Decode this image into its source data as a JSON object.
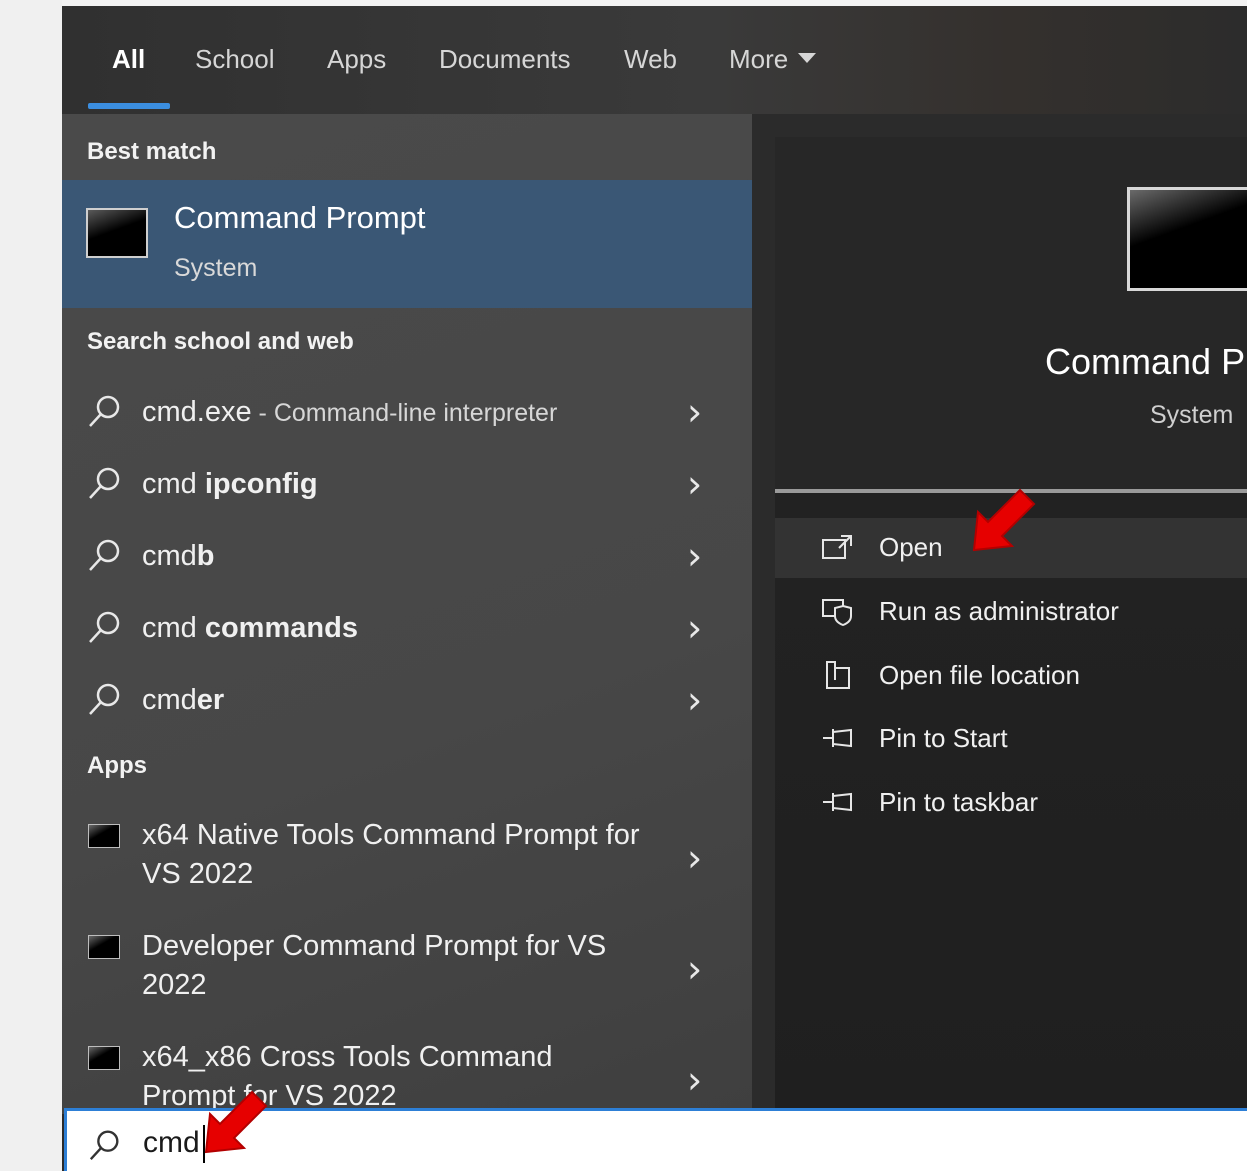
{
  "tabs": [
    {
      "label": "All",
      "active": true
    },
    {
      "label": "School"
    },
    {
      "label": "Apps"
    },
    {
      "label": "Documents"
    },
    {
      "label": "Web"
    },
    {
      "label": "More"
    }
  ],
  "best_match": {
    "heading": "Best match",
    "title": "Command Prompt",
    "subtitle": "System"
  },
  "web_section": {
    "heading": "Search school and web",
    "items": [
      {
        "prefix": "cmd.exe",
        "bold": "",
        "desc": " - Command-line interpreter"
      },
      {
        "prefix": "cmd ",
        "bold": "ipconfig",
        "desc": ""
      },
      {
        "prefix": "cmd",
        "bold": "b",
        "desc": ""
      },
      {
        "prefix": "cmd ",
        "bold": "commands",
        "desc": ""
      },
      {
        "prefix": "cmd",
        "bold": "er",
        "desc": ""
      }
    ]
  },
  "apps_section": {
    "heading": "Apps",
    "items": [
      {
        "label": "x64 Native Tools Command Prompt for VS 2022"
      },
      {
        "label": "Developer Command Prompt for VS 2022"
      },
      {
        "label": "x64_x86 Cross Tools Command Prompt for VS 2022"
      }
    ]
  },
  "detail": {
    "title": "Command Prompt",
    "subtitle": "System",
    "actions": [
      {
        "label": "Open",
        "icon": "open-icon"
      },
      {
        "label": "Run as administrator",
        "icon": "shield-icon"
      },
      {
        "label": "Open file location",
        "icon": "folder-icon"
      },
      {
        "label": "Pin to Start",
        "icon": "pin-icon"
      },
      {
        "label": "Pin to taskbar",
        "icon": "pin-icon"
      }
    ]
  },
  "search": {
    "value": "cmd"
  },
  "colors": {
    "accent": "#3b8ee0",
    "best_match_bg": "#3a5775",
    "arrow": "#e60000"
  }
}
